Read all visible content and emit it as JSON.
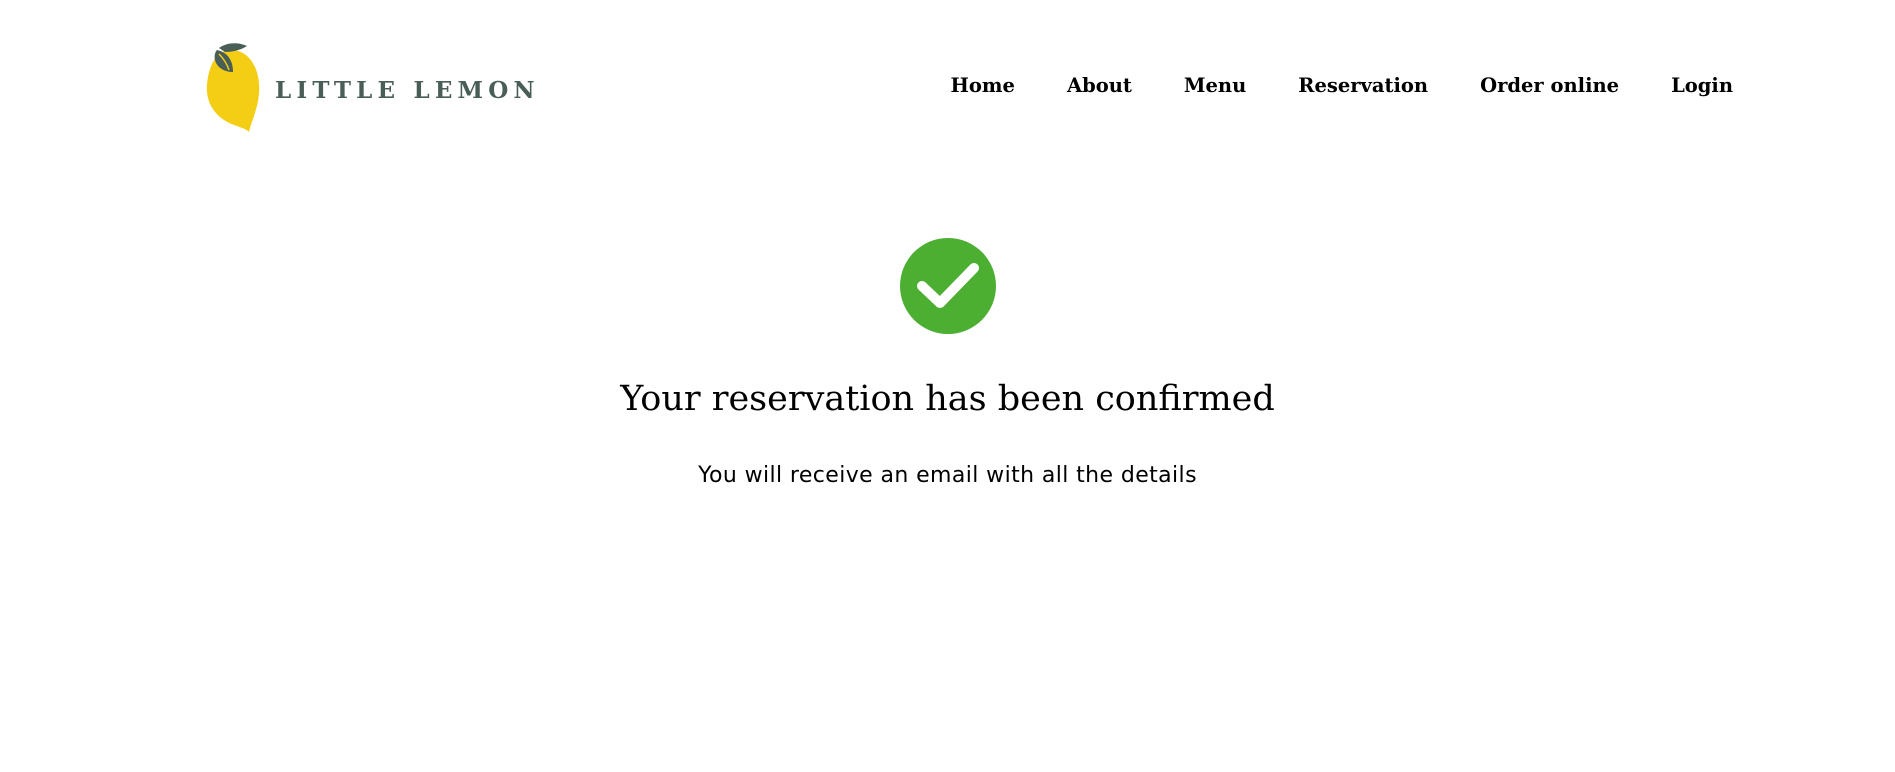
{
  "brand": {
    "name": "LITTLE LEMON",
    "text_color": "#495e57",
    "lemon_color": "#f4ce14",
    "leaf_color": "#495e57"
  },
  "nav": {
    "items": [
      {
        "label": "Home"
      },
      {
        "label": "About"
      },
      {
        "label": "Menu"
      },
      {
        "label": "Reservation"
      },
      {
        "label": "Order online"
      },
      {
        "label": "Login"
      }
    ]
  },
  "confirmation": {
    "icon": "check-circle-icon",
    "icon_color": "#4caf32",
    "title": "Your reservation has been confirmed",
    "subtitle": "You will receive an email with all the details"
  }
}
